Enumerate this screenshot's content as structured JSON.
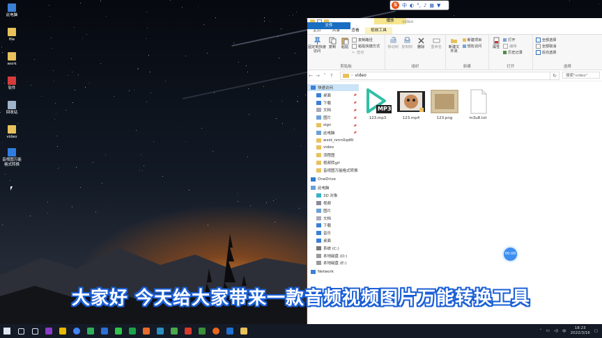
{
  "desktop": {
    "icons": [
      {
        "label": "此电脑",
        "icon": "computer-icon",
        "color": "#3b7fd6"
      },
      {
        "label": "file",
        "icon": "folder-icon",
        "color": "#e8c15c"
      },
      {
        "label": "work",
        "icon": "folder-icon",
        "color": "#e8c15c"
      },
      {
        "label": "软件",
        "icon": "app-icon",
        "color": "#d63b3b"
      },
      {
        "label": "回收站",
        "icon": "recycle-bin-icon",
        "color": "#9fb3c8"
      },
      {
        "label": "video",
        "icon": "folder-icon",
        "color": "#e8c15c"
      },
      {
        "label": "音视图万能格式转换",
        "icon": "converter-app-icon",
        "color": "#2f7de0"
      }
    ]
  },
  "ime": {
    "logo": "S",
    "lang": "中"
  },
  "window": {
    "title": "video",
    "context_tab_group": "播放",
    "tabs": [
      "文件",
      "主页",
      "共享",
      "查看",
      "视频工具"
    ],
    "ribbon": {
      "clipboard": {
        "label": "剪贴板",
        "pin": "固定到快速访问",
        "copy": "复制",
        "paste": "粘贴",
        "copy_path": "复制路径",
        "paste_shortcut": "粘贴快捷方式",
        "cut": "剪切"
      },
      "organize": {
        "label": "组织",
        "move_to": "移动到",
        "copy_to": "复制到",
        "delete": "删除",
        "rename": "重命名"
      },
      "new": {
        "label": "新建",
        "new_folder": "新建文件夹",
        "new_item": "新建项目",
        "easy_access": "轻松访问"
      },
      "open": {
        "label": "打开",
        "properties": "属性",
        "open": "打开",
        "edit": "编辑",
        "history": "历史记录"
      },
      "select": {
        "label": "选择",
        "select_all": "全部选择",
        "select_none": "全部取消",
        "invert": "反向选择"
      }
    },
    "address": {
      "path": "video",
      "search_placeholder": "搜索\"video\""
    },
    "nav": {
      "quick_access": "快速访问",
      "quick_items": [
        "桌面",
        "下载",
        "文档",
        "图片",
        "sign",
        "此电脑",
        "wxid_nmn0qd6l",
        "video",
        "流程图",
        "视频转gif",
        "音视图万能格式转换"
      ],
      "onedrive": "OneDrive",
      "this_pc": "此电脑",
      "pc_items": [
        "3D 对象",
        "视频",
        "图片",
        "文档",
        "下载",
        "音乐",
        "桌面",
        "系统 (C:)",
        "本地磁盘 (D:)",
        "本地磁盘 (E:)"
      ],
      "network": "Network"
    },
    "files": [
      {
        "name": "123.mp3",
        "type": "mp3",
        "badge": "MP3"
      },
      {
        "name": "123.mp4",
        "type": "mp4"
      },
      {
        "name": "123.png",
        "type": "png"
      },
      {
        "name": "m3u8.txt",
        "type": "txt"
      }
    ]
  },
  "recording_timer": "00:00",
  "subtitle": "大家好 今天给大家带来一款音频视频图片万能转换工具",
  "taskbar": {
    "apps": [
      "start",
      "search",
      "task-view",
      "app-purple",
      "app-yellow",
      "chrome",
      "app-green",
      "app-blue",
      "wechat",
      "h-app",
      "app-orange",
      "app-cyan",
      "app-green2",
      "app-red",
      "app-paw",
      "firefox",
      "app-bird",
      "explorer"
    ],
    "ime": "中",
    "time": "18:23",
    "date": "2022/3/16"
  }
}
